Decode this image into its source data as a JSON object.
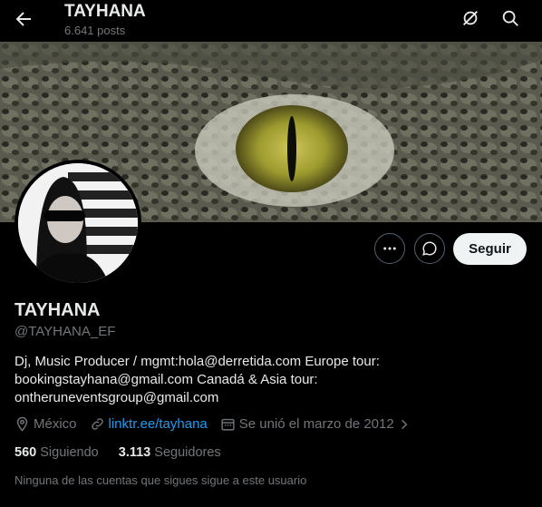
{
  "header": {
    "title": "TAYHANA",
    "posts": "6.641 posts"
  },
  "icons": {
    "back": "arrow-left-icon",
    "no_notify": "notifications-off-icon",
    "search": "search-icon",
    "more": "more-horizontal-icon",
    "message": "message-bubble-icon",
    "location": "location-pin-icon",
    "link": "link-icon",
    "calendar": "calendar-icon",
    "chevron": "chevron-right-icon"
  },
  "profile": {
    "name": "TAYHANA",
    "handle": "@TAYHANA_EF",
    "bio_lines": [
      "Dj, Music Producer / mgmt:hola@derretida.com Europe tour:",
      "bookingstayhana@gmail.com Canadá & Asia tour:",
      "ontheruneventsgroup@gmail.com"
    ],
    "location": "México",
    "link": "linktr.ee/tayhana",
    "joined": "Se unió el marzo de 2012"
  },
  "actions": {
    "follow_label": "Seguir"
  },
  "stats": {
    "following_count": "560",
    "following_label": "Siguiendo",
    "followers_count": "3.113",
    "followers_label": "Seguidores"
  },
  "note": "Ninguna de las cuentas que sigues sigue a este usuario",
  "colors": {
    "link": "#1d9bf0",
    "muted": "#71767b",
    "text": "#e7e9ea"
  }
}
